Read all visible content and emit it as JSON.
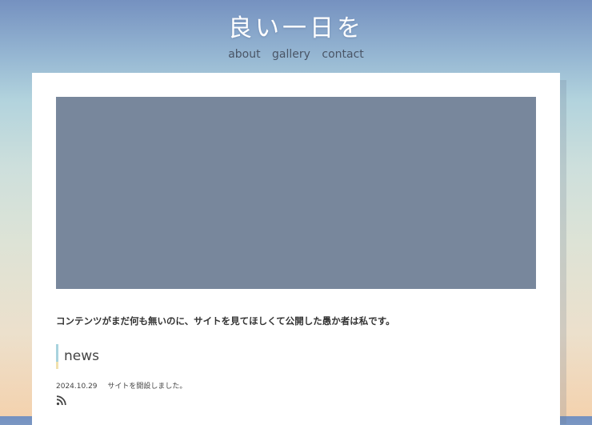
{
  "site": {
    "title": "良い一日を"
  },
  "nav": {
    "items": [
      "about",
      "gallery",
      "contact"
    ]
  },
  "main": {
    "intro": "コンテンツがまだ何も無いのに、サイトを見てほしくて公開した愚か者は私です。",
    "news": {
      "heading": "news",
      "items": [
        {
          "date": "2024.10.29",
          "text": "サイトを開設しました。"
        }
      ],
      "rss_icon": "rss-icon"
    }
  },
  "colors": {
    "hero_placeholder": "#78879c",
    "accent_blue": "#a8d3de",
    "accent_yellow": "#f1e1ae"
  }
}
